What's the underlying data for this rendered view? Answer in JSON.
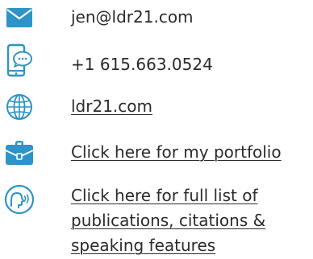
{
  "contacts": {
    "email": {
      "text": "jen@ldr21.com",
      "icon": "envelope-icon"
    },
    "phone": {
      "text": "+1 615.663.0524",
      "icon": "phone-chat-icon"
    },
    "website": {
      "text": "ldr21.com",
      "icon": "globe-icon"
    },
    "portfolio": {
      "text": "Click here for my portfolio",
      "icon": "briefcase-icon"
    },
    "publications": {
      "lines": [
        "Click here for full list of",
        "publications, citations &",
        "speaking features"
      ],
      "icon": "speaking-head-icon"
    }
  },
  "colors": {
    "accent": "#2d93c8",
    "text": "#2b2b2b"
  }
}
